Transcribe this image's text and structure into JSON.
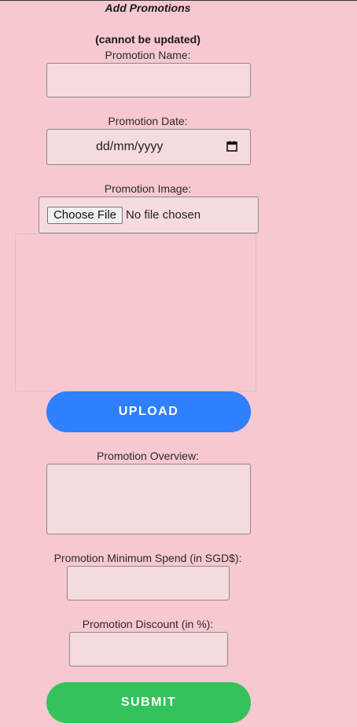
{
  "header": {
    "title": "Add Promotions",
    "note": "(cannot be updated)"
  },
  "form": {
    "name_label": "Promotion Name:",
    "name_value": "",
    "date_label": "Promotion Date:",
    "date_placeholder": "dd/mm/yyyy",
    "image_label": "Promotion Image:",
    "choose_file_label": "Choose File",
    "no_file_text": "No file chosen",
    "upload_label": "UPLOAD",
    "overview_label": "Promotion Overview:",
    "overview_value": "",
    "min_spend_label": "Promotion Minimum Spend (in SGD$):",
    "min_spend_value": "",
    "discount_label": "Promotion Discount (in %):",
    "discount_value": "",
    "submit_label": "SUBMIT"
  },
  "icons": {
    "date_picker": "calendar-icon"
  },
  "colors": {
    "background": "#f7c8d0",
    "field_background": "#f5dade",
    "upload_button": "#2f80ff",
    "submit_button": "#34c35a"
  }
}
